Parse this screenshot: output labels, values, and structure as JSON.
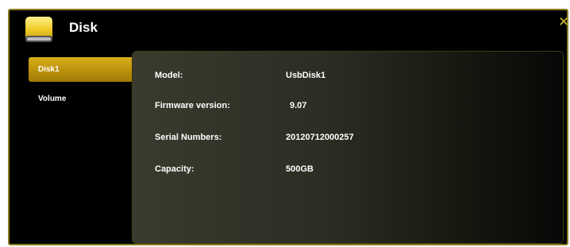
{
  "window": {
    "title": "Disk",
    "icon": "disk-icon",
    "close_icon": "close-icon"
  },
  "colors": {
    "accent": "#c8a010",
    "frame": "#8a7a1e",
    "background": "#000000"
  },
  "sidebar": {
    "items": [
      {
        "label": "Disk1",
        "active": true
      },
      {
        "label": "Volume",
        "active": false
      }
    ]
  },
  "details": {
    "model_label": "Model:",
    "model_value": "UsbDisk1",
    "firmware_label": "Firmware version:",
    "firmware_value": "9.07",
    "serial_label": "Serial Numbers:",
    "serial_value": "20120712000257",
    "capacity_label": "Capacity:",
    "capacity_value": "500GB"
  }
}
